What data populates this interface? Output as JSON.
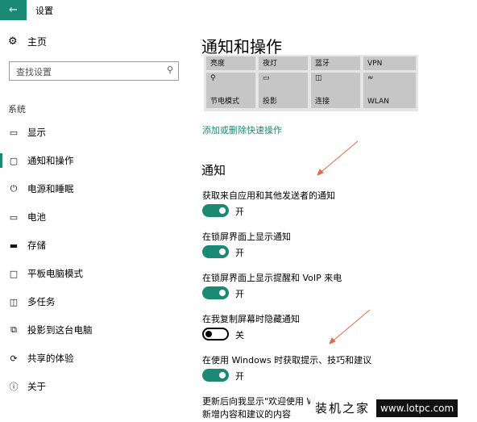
{
  "window": {
    "title": "设置",
    "back_icon": "arrow-left-icon"
  },
  "sidebar": {
    "home_label": "主页",
    "search_placeholder": "查找设置",
    "section_label": "系统",
    "items": [
      {
        "label": "显示",
        "icon": "monitor-icon"
      },
      {
        "label": "通知和操作",
        "icon": "chat-bubble-icon",
        "active": true
      },
      {
        "label": "电源和睡眠",
        "icon": "power-icon"
      },
      {
        "label": "电池",
        "icon": "battery-icon"
      },
      {
        "label": "存储",
        "icon": "storage-icon"
      },
      {
        "label": "平板电脑模式",
        "icon": "tablet-icon"
      },
      {
        "label": "多任务",
        "icon": "multitask-icon"
      },
      {
        "label": "投影到这台电脑",
        "icon": "project-icon"
      },
      {
        "label": "共享的体验",
        "icon": "share-icon"
      },
      {
        "label": "关于",
        "icon": "info-icon"
      }
    ]
  },
  "main": {
    "title": "通知和操作",
    "quick_actions": [
      "亮度",
      "夜灯",
      "蓝牙",
      "VPN",
      "节电模式",
      "投影",
      "连接",
      "WLAN"
    ],
    "edit_link": "添加或删除快速操作",
    "notifications_heading": "通知",
    "settings": [
      {
        "label": "获取来自应用和其他发送者的通知",
        "state": "开",
        "on": true
      },
      {
        "label": "在锁屏界面上显示通知",
        "state": "开",
        "on": true
      },
      {
        "label": "在锁屏界面上显示提醒和 VoIP 来电",
        "state": "开",
        "on": true
      },
      {
        "label": "在我复制屏幕时隐藏通知",
        "state": "关",
        "on": false
      },
      {
        "label": "在使用 Windows 时获取提示、技巧和建议",
        "state": "开",
        "on": true
      }
    ],
    "last_setting_line1": "更新后向我显示\"欢迎使用 W",
    "last_setting_line2": "新增内容和建议的内容"
  },
  "watermark": {
    "logo_text": "装机之家",
    "url": "www.lotpc.com"
  },
  "colors": {
    "accent": "#1a8a74",
    "tile_bg": "#c6c6c6",
    "annotation_arrow": "#e06a4a"
  }
}
